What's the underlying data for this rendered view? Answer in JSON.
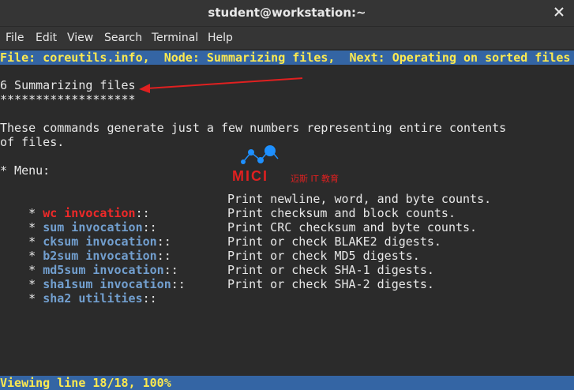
{
  "window": {
    "title": "student@workstation:~"
  },
  "menu": [
    "File",
    "Edit",
    "View",
    "Search",
    "Terminal",
    "Help"
  ],
  "terminal": {
    "header": "File: coreutils.info,  Node: Summarizing files,  Next: Operating on sorted files",
    "heading": "6 Summarizing files",
    "underline": "*******************",
    "intro1": "These commands generate just a few numbers representing entire contents",
    "intro2": "of files.",
    "menu_label": "* Menu:",
    "items": [
      {
        "bullet": "* ",
        "name": "wc invocation",
        "sep": "::",
        "desc": "Print newline, word, and byte counts."
      },
      {
        "bullet": "* ",
        "name": "sum invocation",
        "sep": "::",
        "desc": "Print checksum and block counts."
      },
      {
        "bullet": "* ",
        "name": "cksum invocation",
        "sep": "::",
        "desc": "Print CRC checksum and byte counts."
      },
      {
        "bullet": "* ",
        "name": "b2sum invocation",
        "sep": "::",
        "desc": "Print or check BLAKE2 digests."
      },
      {
        "bullet": "* ",
        "name": "md5sum invocation",
        "sep": "::",
        "desc": "Print or check MD5 digests."
      },
      {
        "bullet": "* ",
        "name": "sha1sum invocation",
        "sep": "::",
        "desc": "Print or check SHA-1 digests."
      },
      {
        "bullet": "* ",
        "name": "sha2 utilities",
        "sep": "::",
        "desc": "Print or check SHA-2 digests."
      }
    ],
    "status": "Viewing line 18/18, 100%"
  },
  "watermark": {
    "brand": "MICI",
    "sub": "迈斯 IT 教育"
  },
  "colors": {
    "link": "#729fcf",
    "selected_link": "#ef2929",
    "bar": "#3465a4",
    "bar_text": "#fce94f"
  }
}
